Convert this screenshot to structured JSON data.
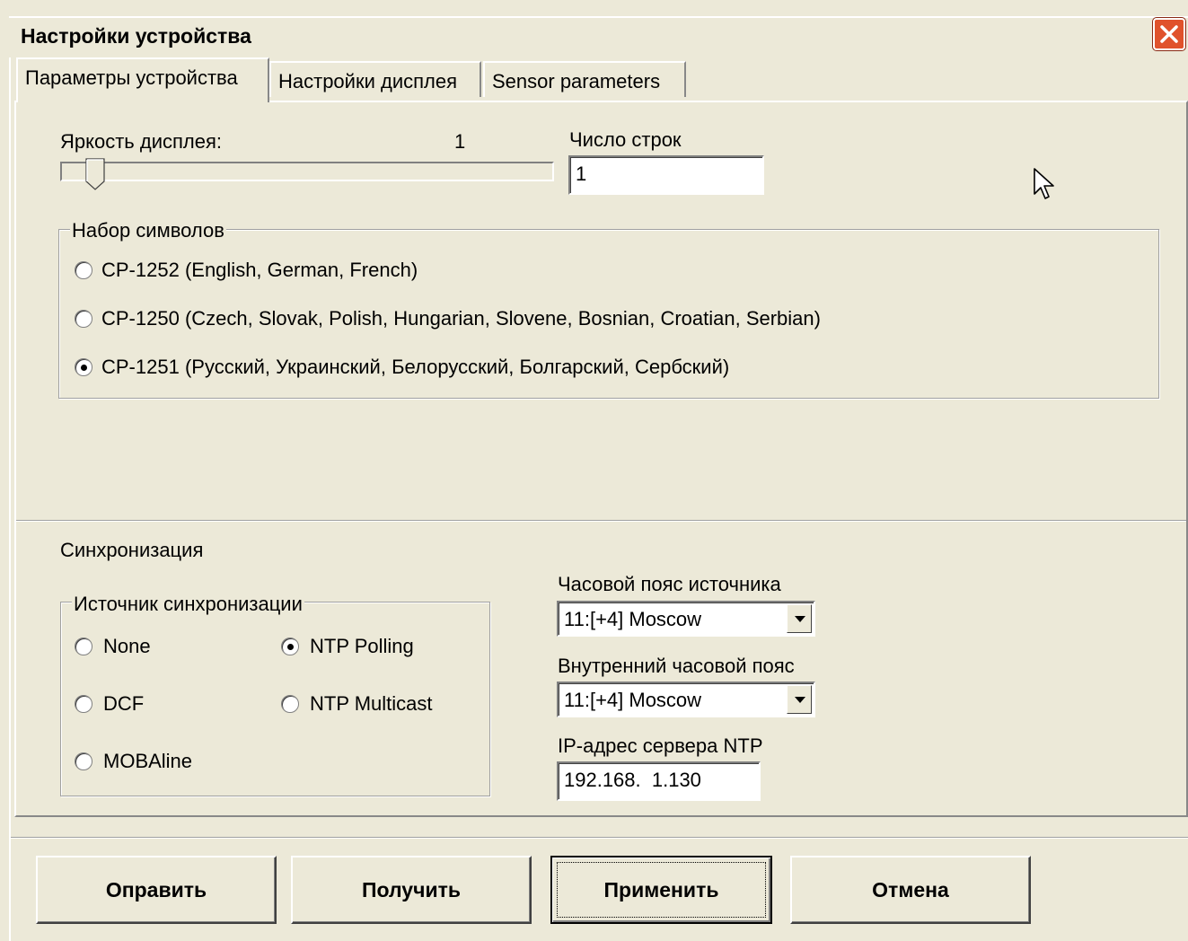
{
  "window": {
    "title": "Настройки устройства"
  },
  "tabs": [
    {
      "label": "Параметры устройства",
      "active": true
    },
    {
      "label": "Настройки дисплея",
      "active": false
    },
    {
      "label": "Sensor parameters",
      "active": false
    }
  ],
  "display": {
    "brightness_label": "Яркость дисплея:",
    "brightness_value": "1",
    "rows_label": "Число строк",
    "rows_value": "1"
  },
  "charset": {
    "group_label": "Набор символов",
    "options": [
      {
        "label": "CP-1252 (English, German, French)",
        "selected": false
      },
      {
        "label": "CP-1250 (Czech, Slovak, Polish, Hungarian, Slovene, Bosnian, Croatian, Serbian)",
        "selected": false
      },
      {
        "label": "CP-1251 (Русский, Украинский, Белорусский, Болгарский, Сербский)",
        "selected": true
      }
    ]
  },
  "sync": {
    "section_label": "Синхронизация",
    "source_group_label": "Источник синхронизации",
    "sources": [
      {
        "label": "None",
        "selected": false
      },
      {
        "label": "NTP Polling",
        "selected": true
      },
      {
        "label": "DCF",
        "selected": false
      },
      {
        "label": "NTP Multicast",
        "selected": false
      },
      {
        "label": "MOBAline",
        "selected": false
      }
    ],
    "source_tz_label": "Часовой пояс источника",
    "source_tz_value": "11:[+4] Moscow",
    "internal_tz_label": "Внутренний часовой пояс",
    "internal_tz_value": "11:[+4] Moscow",
    "ntp_ip_label": "IP-адрес сервера NTP",
    "ntp_ip_value": "192.168.  1.130"
  },
  "buttons": {
    "send": "Оправить",
    "receive": "Получить",
    "apply": "Применить",
    "cancel": "Отмена"
  },
  "colors": {
    "window_bg": "#ece9d8",
    "close_button": "#e0522c"
  }
}
